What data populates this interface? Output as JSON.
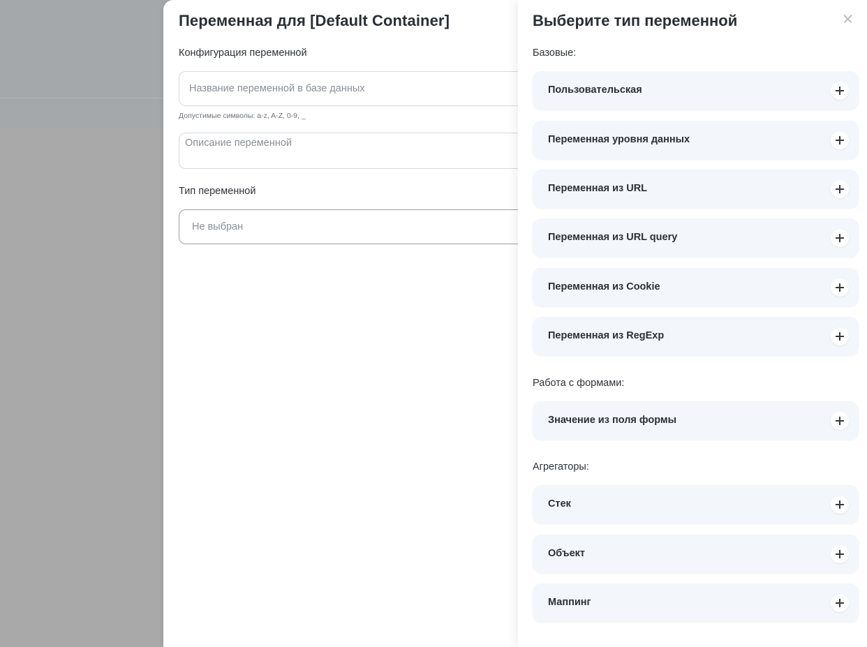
{
  "form": {
    "title": "Переменная для [Default Container]",
    "config_label": "Конфигурация переменной",
    "name_placeholder": "Название переменной в базе данных",
    "allowed_chars_hint": "Допустимые символы: a-z, A-Z, 0-9, _",
    "description_placeholder": "Описание переменной",
    "type_label": "Тип переменной",
    "type_value": "Не выбран"
  },
  "panel": {
    "title": "Выберите тип переменной",
    "groups": {
      "basic": {
        "label": "Базовые:",
        "items": [
          "Пользовательская",
          "Переменная уровня данных",
          "Переменная из URL",
          "Переменная из URL query",
          "Переменная из Cookie",
          "Переменная из RegExp"
        ]
      },
      "forms": {
        "label": "Работа с формами:",
        "items": [
          "Значение из поля формы"
        ]
      },
      "aggregators": {
        "label": "Агрегаторы:",
        "items": [
          "Стек",
          "Объект",
          "Маппинг"
        ]
      }
    }
  },
  "icons": {
    "close": "close-icon",
    "add": "plus-icon"
  }
}
